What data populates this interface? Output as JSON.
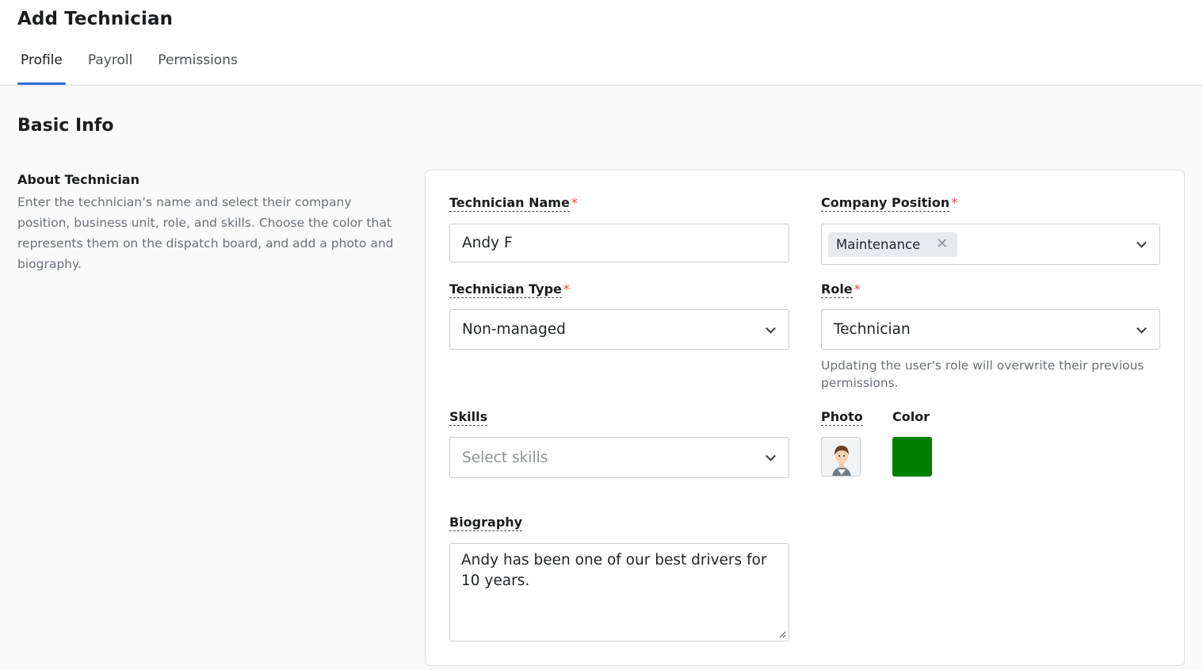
{
  "page": {
    "title": "Add Technician",
    "tabs": [
      {
        "label": "Profile",
        "active": true
      },
      {
        "label": "Payroll",
        "active": false
      },
      {
        "label": "Permissions",
        "active": false
      }
    ]
  },
  "basic_info": {
    "section_title": "Basic Info",
    "about_title": "About Technician",
    "about_description": "Enter the technician’s name and select their company position, business unit, role, and skills. Choose the color that represents them on the dispatch board, and add a photo and biography."
  },
  "form": {
    "technician_name": {
      "label": "Technician Name",
      "required_mark": "*",
      "value": "Andy F"
    },
    "company_position": {
      "label": "Company Position",
      "required_mark": "*",
      "selected_chip": "Maintenance",
      "chip_remove_icon": "close-icon"
    },
    "technician_type": {
      "label": "Technician Type",
      "required_mark": "*",
      "value": "Non-managed"
    },
    "role": {
      "label": "Role",
      "required_mark": "*",
      "value": "Technician",
      "help_text": "Updating the user's role will overwrite their previous permissions."
    },
    "skills": {
      "label": "Skills",
      "placeholder": "Select skills"
    },
    "photo": {
      "label": "Photo",
      "icon": "technician-avatar"
    },
    "color": {
      "label": "Color",
      "value": "#008000"
    },
    "biography": {
      "label": "Biography",
      "value": "Andy has been one of our best drivers for 10 years."
    }
  },
  "colors": {
    "accent": "#2f6fd6",
    "required": "#e5484d",
    "technician_color": "#008000"
  }
}
